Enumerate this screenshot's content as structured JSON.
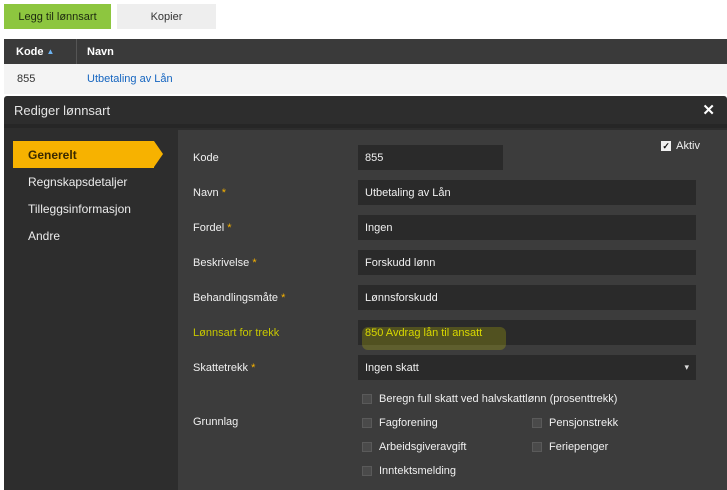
{
  "toolbar": {
    "add_label": "Legg til lønnsart",
    "copy_label": "Kopier"
  },
  "list": {
    "columns": {
      "kode": "Kode",
      "navn": "Navn"
    },
    "row": {
      "kode": "855",
      "navn": "Utbetaling av Lån"
    }
  },
  "modal": {
    "title": "Rediger lønnsart",
    "nav": [
      "Generelt",
      "Regnskapsdetaljer",
      "Tilleggsinformasjon",
      "Andre"
    ],
    "form": {
      "kode_label": "Kode",
      "kode_value": "855",
      "aktiv_label": "Aktiv",
      "navn_label": "Navn",
      "navn_value": "Utbetaling av Lån",
      "fordel_label": "Fordel",
      "fordel_value": "Ingen",
      "beskrivelse_label": "Beskrivelse",
      "beskrivelse_value": "Forskudd lønn",
      "behandling_label": "Behandlingsmåte",
      "behandling_value": "Lønnsforskudd",
      "trekk_label": "Lønnsart for trekk",
      "trekk_value": "850 Avdrag lån til ansatt",
      "skatt_label": "Skattetrekk",
      "skatt_value": "Ingen skatt",
      "grunnlag_label": "Grunnlag",
      "required_mark": "*",
      "checkboxes": {
        "beregn": "Beregn full skatt ved halvskattlønn (prosenttrekk)",
        "fagforening": "Fagforening",
        "pensjon": "Pensjonstrekk",
        "aga": "Arbeidsgiveravgift",
        "feriepenger": "Feriepenger",
        "inntekt": "Inntektsmelding"
      }
    }
  }
}
